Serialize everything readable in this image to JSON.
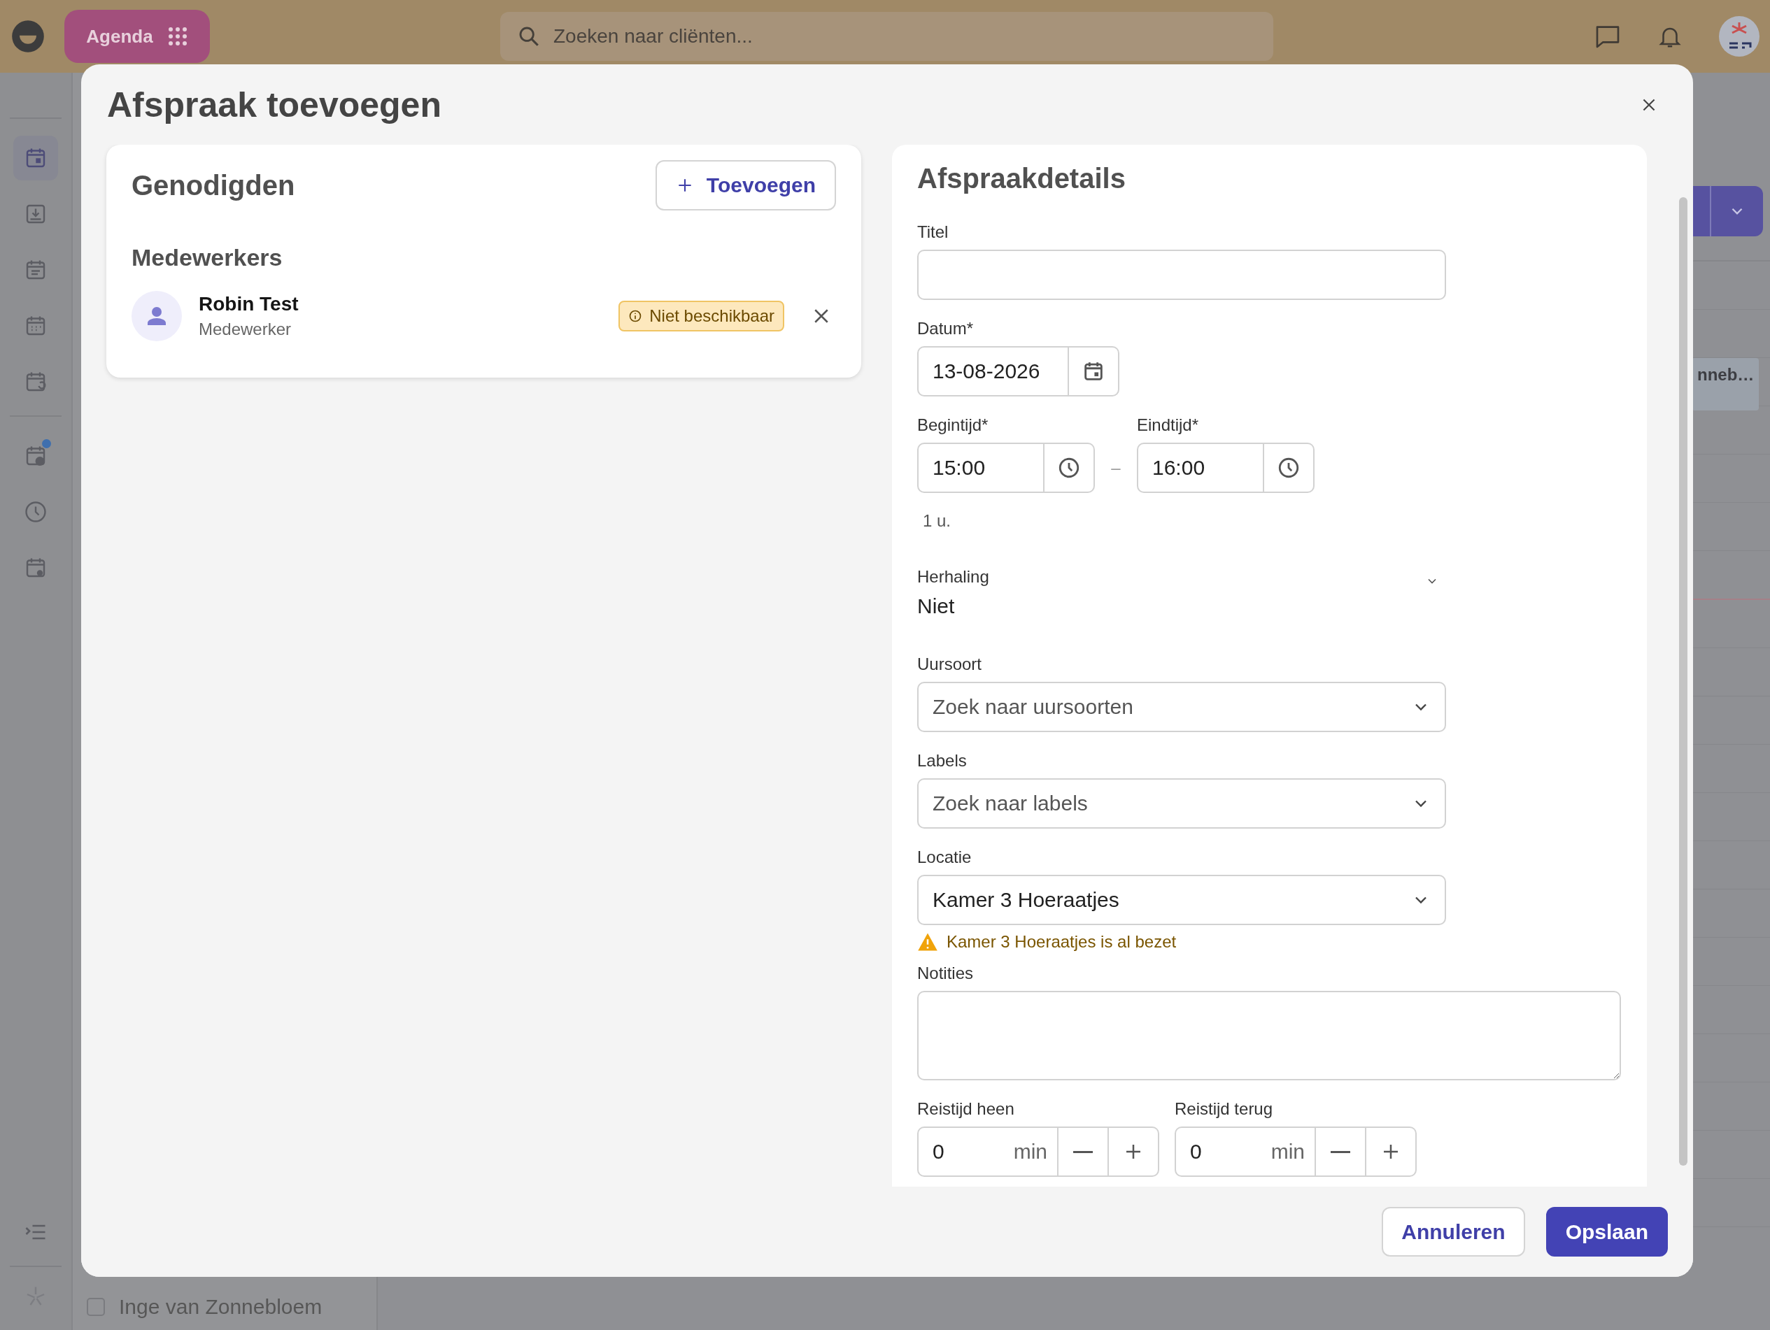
{
  "top_bar": {
    "app_button": "Agenda",
    "search": {
      "placeholder": "Zoeken naar cliënten..."
    }
  },
  "sidebar": {
    "items": [
      {
        "selected": true,
        "notification": false
      },
      {
        "selected": false,
        "notification": false
      },
      {
        "selected": false,
        "notification": false
      },
      {
        "selected": false,
        "notification": false
      },
      {
        "selected": false,
        "notification": false
      },
      {
        "selected": false,
        "notification": true
      },
      {
        "selected": false,
        "notification": false
      },
      {
        "selected": false,
        "notification": false
      }
    ]
  },
  "client_list": [
    {
      "name": "Inge van Zonnebloem",
      "checked": false
    }
  ],
  "calendar": {
    "events": [
      {
        "title": "nneb…"
      }
    ]
  },
  "modal": {
    "title": "Afspraak toevoegen",
    "guests": {
      "title": "Genodigden",
      "add_button": "Toevoegen",
      "groups": [
        {
          "title": "Medewerkers",
          "people": [
            {
              "name": "Robin Test",
              "role": "Medewerker",
              "status": "Niet beschikbaar"
            }
          ]
        }
      ]
    },
    "details": {
      "title": "Afspraakdetails",
      "fields": [
        {
          "kind": "text",
          "label": "Titel"
        },
        {
          "kind": "date",
          "label": "Datum*",
          "value": "13-08-2026"
        },
        {
          "kind": "time_range",
          "start_label": "Begintijd*",
          "start": "15:00",
          "separator": "–",
          "end_label": "Eindtijd*",
          "end": "16:00",
          "duration": "1 u."
        },
        {
          "kind": "dropdown",
          "label": "Herhaling",
          "value": "Niet"
        },
        {
          "kind": "select",
          "label": "Uursoort",
          "placeholder": "Zoek naar uursoorten"
        },
        {
          "kind": "select",
          "label": "Labels",
          "placeholder": "Zoek naar labels"
        },
        {
          "kind": "select",
          "label": "Locatie",
          "value": "Kamer 3 Hoeraatjes",
          "warning": "Kamer 3 Hoeraatjes is al bezet"
        },
        {
          "kind": "textarea",
          "label": "Notities"
        },
        {
          "kind": "travel",
          "items": [
            {
              "label": "Reistijd heen",
              "value": "0",
              "unit": "min"
            },
            {
              "label": "Reistijd terug",
              "value": "0",
              "unit": "min"
            }
          ]
        }
      ]
    },
    "buttons": [
      {
        "label": "Annuleren",
        "kind": "secondary"
      },
      {
        "label": "Opslaan",
        "kind": "primary"
      }
    ]
  }
}
